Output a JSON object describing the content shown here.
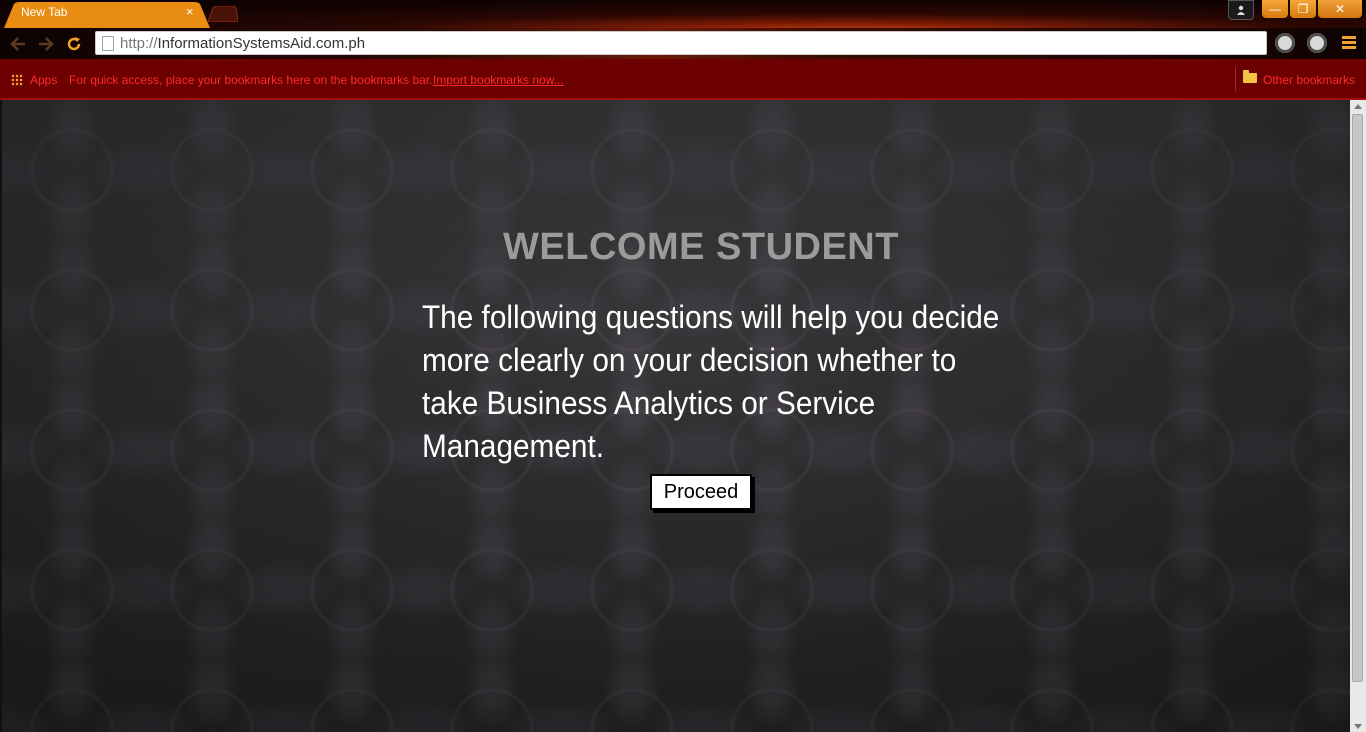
{
  "browser": {
    "tab": {
      "title": "New Tab",
      "close_glyph": "×"
    },
    "window_controls": {
      "user_icon": "user-icon",
      "minimize": "—",
      "maximize": "❐",
      "close": "✕"
    },
    "toolbar": {
      "back_icon": "back-arrow-icon",
      "forward_icon": "forward-arrow-icon",
      "reload_icon": "reload-icon"
    },
    "omnibox": {
      "scheme": "http://",
      "host": "InformationSystemsAid.com.ph"
    },
    "bookmarks_bar": {
      "apps_label": "Apps",
      "hint_text": "For quick access, place your bookmarks here on the bookmarks bar.",
      "import_link": "Import bookmarks now...",
      "other_bookmarks": "Other bookmarks"
    },
    "colors": {
      "tab_accent": "#f0a22a",
      "bookmark_bar_bg": "#6d0000",
      "bookmark_text": "#ff2a2a"
    }
  },
  "page": {
    "heading": "WELCOME STUDENT",
    "message": "The following questions will help you decide more clearly on your decision whether to take Business Analytics or Service Management.",
    "proceed_label": "Proceed",
    "colors": {
      "heading": "#9b9b9b",
      "message": "#ffffff",
      "background": "#333234"
    }
  }
}
